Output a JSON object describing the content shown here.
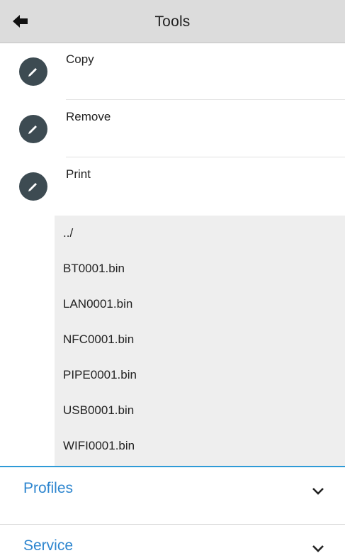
{
  "header": {
    "title": "Tools",
    "back_icon": "back-arrow-icon"
  },
  "tools": [
    {
      "label": "Copy",
      "icon": "edit-icon"
    },
    {
      "label": "Remove",
      "icon": "edit-icon"
    },
    {
      "label": "Print",
      "icon": "edit-icon"
    }
  ],
  "files": [
    "../",
    "BT0001.bin",
    "LAN0001.bin",
    "NFC0001.bin",
    "PIPE0001.bin",
    "USB0001.bin",
    "WIFI0001.bin"
  ],
  "sections": [
    {
      "title": "Profiles",
      "icon": "chevron-down-icon"
    },
    {
      "title": "Service",
      "icon": "chevron-down-icon"
    }
  ],
  "colors": {
    "header_bg": "#dcdcdc",
    "icon_circle": "#3d4b52",
    "file_list_bg": "#eeeeee",
    "section_title": "#2e86cf",
    "accent_line": "#2e9ad7"
  }
}
